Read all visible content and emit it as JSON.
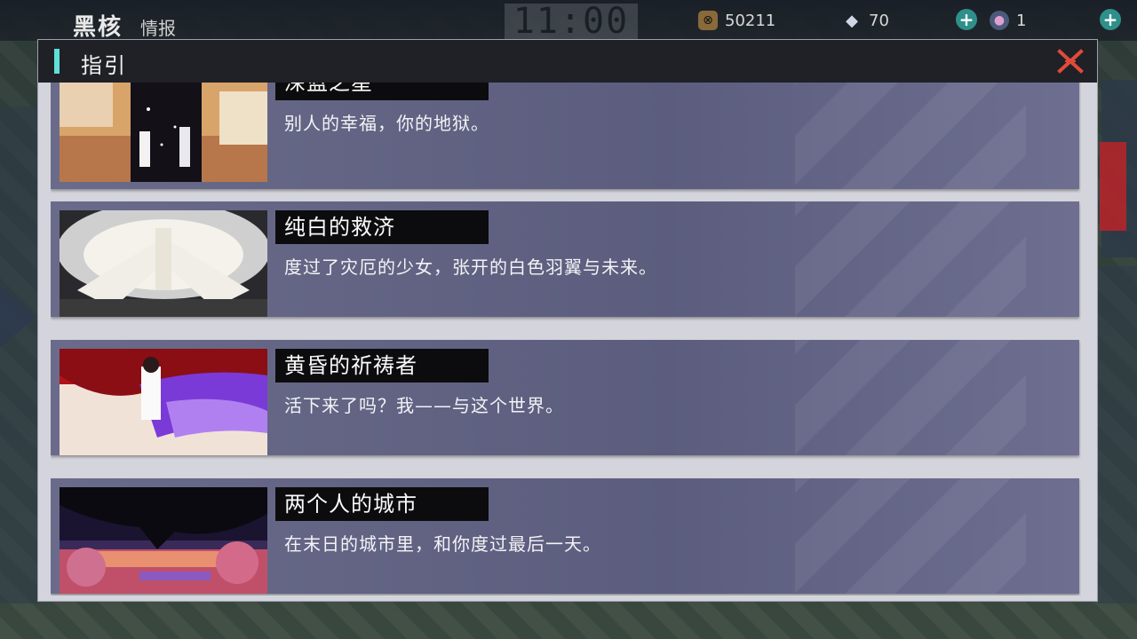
{
  "hud": {
    "title": "黑核",
    "subtitle": "情报",
    "clock": "11:00",
    "resources": [
      {
        "icon": "currency-coin-icon",
        "value": "50211"
      },
      {
        "icon": "diamond-gem-icon",
        "value": "70"
      },
      {
        "icon": "energy-orb-icon",
        "value": "1"
      }
    ]
  },
  "dialog": {
    "title": "指引",
    "entries": [
      {
        "name": "深蓝之星",
        "description": "别人的幸福，你的地狱。"
      },
      {
        "name": "纯白的救济",
        "description": "度过了灾厄的少女，张开的白色羽翼与未来。"
      },
      {
        "name": "黄昏的祈祷者",
        "description": "活下来了吗？我——与这个世界。"
      },
      {
        "name": "两个人的城市",
        "description": "在末日的城市里，和你度过最后一天。"
      }
    ]
  },
  "colors": {
    "accent": "#5fe0d8",
    "close": "#e24a3a",
    "card": "#62637f",
    "header": "#1f2126"
  }
}
